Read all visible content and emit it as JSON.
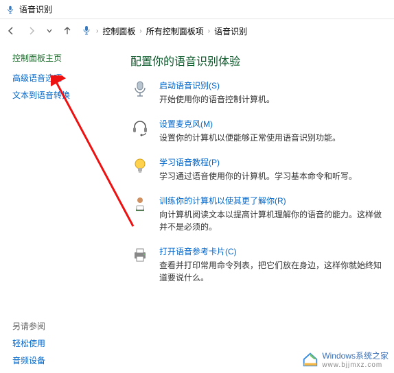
{
  "window": {
    "title": "语音识别"
  },
  "breadcrumb": {
    "root": "控制面板",
    "mid": "所有控制面板项",
    "leaf": "语音识别"
  },
  "sidebar": {
    "home": "控制面板主页",
    "links": [
      "高级语音选项",
      "文本到语音转换"
    ],
    "see_also_label": "另请参阅",
    "see_also": [
      "轻松使用",
      "音频设备"
    ]
  },
  "main": {
    "heading": "配置你的语音识别体验",
    "items": [
      {
        "title": "启动语音识别(S)",
        "desc": "开始使用你的语音控制计算机。"
      },
      {
        "title": "设置麦克风(M)",
        "desc": "设置你的计算机以便能够正常使用语音识别功能。"
      },
      {
        "title": "学习语音教程(P)",
        "desc": "学习通过语音使用你的计算机。学习基本命令和听写。"
      },
      {
        "title": "训练你的计算机以使其更了解你(R)",
        "desc": "向计算机阅读文本以提高计算机理解你的语音的能力。这样做并不是必须的。"
      },
      {
        "title": "打开语音参考卡片(C)",
        "desc": "查看并打印常用命令列表，把它们放在身边，这样你就始终知道要说什么。"
      }
    ]
  },
  "watermark": {
    "brand": "Windows系统之家",
    "url": "www.bjjmxz.com"
  }
}
